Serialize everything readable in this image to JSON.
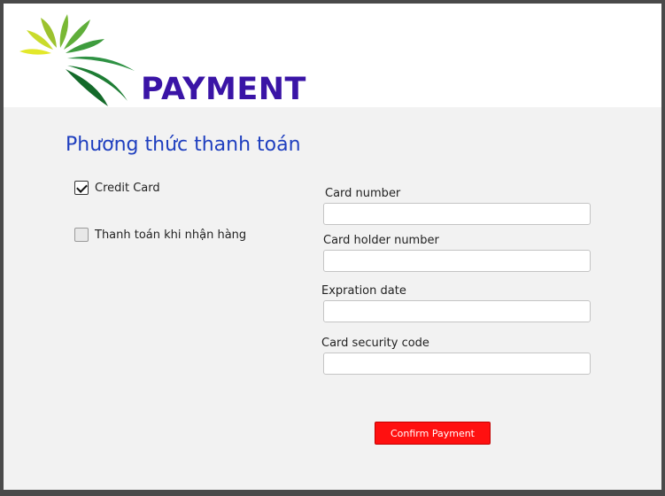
{
  "header": {
    "title": "PAYMENT",
    "logo_icon": "leaf-fan-logo"
  },
  "payment_method": {
    "title": "Phương thức thanh toán",
    "options": [
      {
        "label": "Credit Card",
        "checked": true
      },
      {
        "label": "Thanh toán khi nhận hàng",
        "checked": false
      }
    ]
  },
  "card_form": {
    "card_number": {
      "label": "Card number",
      "value": ""
    },
    "card_holder": {
      "label": "Card holder number",
      "value": ""
    },
    "expiration": {
      "label": "Expration date",
      "value": ""
    },
    "security_code": {
      "label": "Card security code",
      "value": ""
    }
  },
  "confirm_button": {
    "label": "Confirm Payment",
    "color": "#ff1010"
  },
  "colors": {
    "title": "#3a14a6",
    "section_title": "#1f3fbf"
  }
}
